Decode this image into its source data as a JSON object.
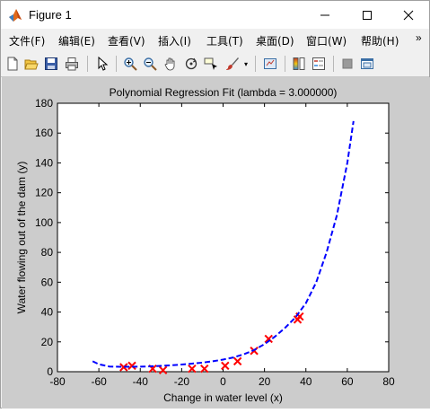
{
  "window": {
    "title": "Figure 1",
    "controls": [
      "minimize",
      "maximize",
      "close"
    ]
  },
  "menu": {
    "items": [
      "文件(F)",
      "编辑(E)",
      "查看(V)",
      "插入(I)",
      "工具(T)",
      "桌面(D)",
      "窗口(W)",
      "帮助(H)"
    ],
    "overflow": "»"
  },
  "toolbar": {
    "buttons": [
      "new-figure-icon",
      "open-file-icon",
      "save-icon",
      "print-icon",
      "select-arrow-icon",
      "zoom-in-icon",
      "zoom-out-icon",
      "pan-hand-icon",
      "rotate-3d-icon",
      "data-cursor-icon",
      "brush-icon",
      "link-plot-icon",
      "colorbar-icon",
      "legend-icon",
      "hide-plot-tools-icon",
      "show-plot-tools-icon"
    ]
  },
  "chart_data": {
    "type": "scatter",
    "title": "Polynomial Regression Fit (lambda = 3.000000)",
    "xlabel": "Change in water level (x)",
    "ylabel": "Water flowing out of the dam (y)",
    "xlim": [
      -80,
      80
    ],
    "ylim": [
      0,
      180
    ],
    "xticks": [
      -80,
      -60,
      -40,
      -20,
      0,
      20,
      40,
      60,
      80
    ],
    "yticks": [
      0,
      20,
      40,
      60,
      80,
      100,
      120,
      140,
      160,
      180
    ],
    "grid": false,
    "series": [
      {
        "kind": "points",
        "marker": "x",
        "color": "#ff0000",
        "x": [
          -48,
          -44,
          -34,
          -29,
          -15,
          -9,
          1,
          7,
          15,
          22,
          36,
          37
        ],
        "y": [
          3,
          4,
          2,
          1,
          2,
          2,
          4,
          7,
          14,
          22,
          35,
          37
        ]
      },
      {
        "kind": "line",
        "style": "dashed",
        "color": "#0000ff",
        "x": [
          -63,
          -60,
          -55,
          -50,
          -45,
          -40,
          -35,
          -30,
          -25,
          -20,
          -15,
          -10,
          -5,
          0,
          5,
          10,
          15,
          20,
          25,
          30,
          35,
          40,
          45,
          50,
          55,
          60,
          63
        ],
        "y": [
          7,
          5,
          3.5,
          3.3,
          3.3,
          3.4,
          3.6,
          3.9,
          4.3,
          4.8,
          5.4,
          6.1,
          7.0,
          8.1,
          9.6,
          11.7,
          14.5,
          18.5,
          23.5,
          29.5,
          36.5,
          46,
          60,
          80,
          105,
          140,
          168
        ]
      }
    ]
  }
}
